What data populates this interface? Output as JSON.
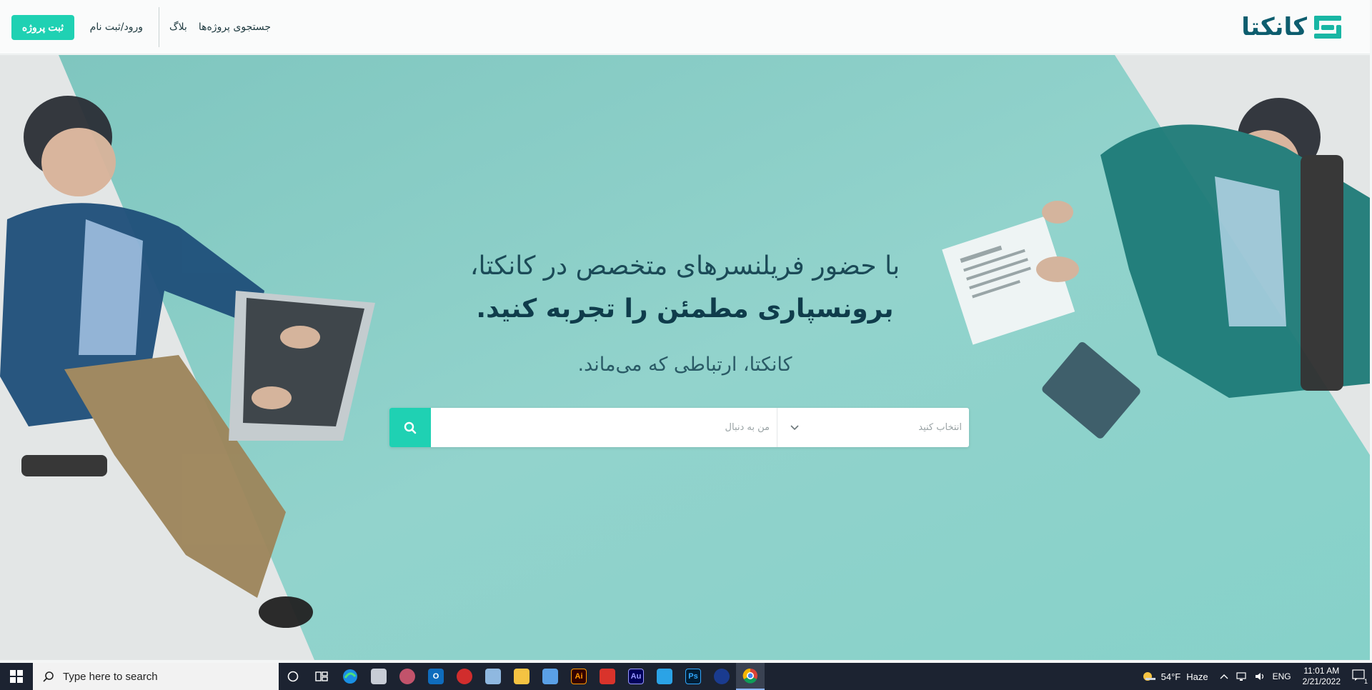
{
  "header": {
    "logo_text": "کانکتا",
    "nav": {
      "search_projects": "جستجوی پروژه‌ها",
      "blog": "بلاگ",
      "login": "ورود/ثبت نام"
    },
    "cta_label": "ثبت پروژه"
  },
  "hero": {
    "line1": "با حضور فریلنسرهای متخصص در کانکتا،",
    "line2": "برونسپاری مطمئن را تجربه کنید.",
    "tagline": "کانکتا، ارتباطی که می‌ماند.",
    "search": {
      "select_placeholder": "انتخاب کنید",
      "input_placeholder": "من به دنبال"
    }
  },
  "taskbar": {
    "search_placeholder": "Type here to search",
    "apps": [
      "cortana-icon",
      "task-view-icon",
      "edge-icon",
      "app-icon",
      "app-icon",
      "outlook-icon",
      "app-icon",
      "app-icon",
      "file-explorer-icon",
      "app-icon",
      "illustrator-icon",
      "app-icon",
      "audition-icon",
      "app-icon",
      "photoshop-icon",
      "app-icon",
      "chrome-icon"
    ],
    "weather": {
      "temp": "54°F",
      "condition": "Haze"
    },
    "lang": "ENG",
    "time": "11:01 AM",
    "date": "2/21/2022",
    "notification_count": "1"
  },
  "colors": {
    "accent": "#1fd1b3",
    "brand_dark": "#0d5d6e",
    "hero_teal": "#8fd3c9"
  }
}
